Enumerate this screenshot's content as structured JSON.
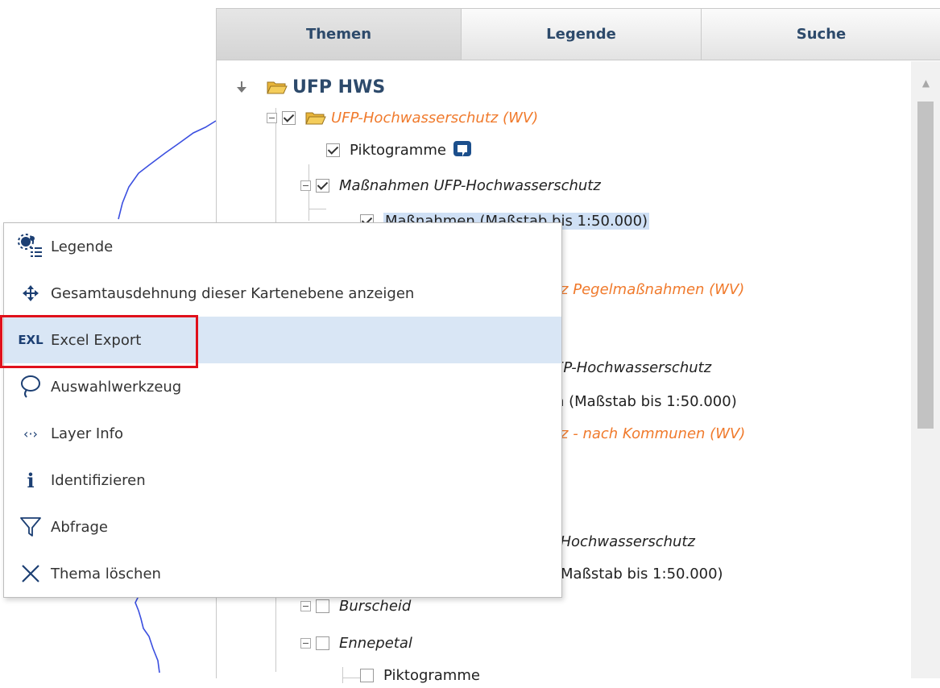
{
  "tabs": [
    {
      "label": "Themen",
      "active": true
    },
    {
      "label": "Legende",
      "active": false
    },
    {
      "label": "Suche",
      "active": false
    }
  ],
  "tree": {
    "root": "UFP HWS",
    "group1": "UFP-Hochwasserschutz (WV)",
    "piktogramme": "Piktogramme",
    "massnahmen_group": "Maßnahmen UFP-Hochwasserschutz",
    "massnahmen_layer": "Maßnahmen (Maßstab bis 1:50.000)",
    "pegel_partial": "tz Pegelmaßnahmen (WV)",
    "massnahmen_group2_partial": "FP-Hochwasserschutz",
    "massnahmen_layer2_partial": "n (Maßstab bis 1:50.000)",
    "kommunen_partial": "tz - nach Kommunen (WV)",
    "massnahmen_group3_partial": "-Hochwasserschutz",
    "massnahmen_layer3_partial": "(Maßstab bis 1:50.000)",
    "burscheid": "Burscheid",
    "ennepetal": "Ennepetal",
    "piktogramme2": "Piktogramme"
  },
  "context_menu": {
    "items": [
      {
        "label": "Legende",
        "icon": "legend-icon"
      },
      {
        "label": "Gesamtausdehnung dieser Kartenebene anzeigen",
        "icon": "move-arrows-icon"
      },
      {
        "label": "Excel Export",
        "icon": "excel-export-icon",
        "icon_text": "EXL",
        "hovered": true,
        "highlighted": true
      },
      {
        "label": "Auswahlwerkzeug",
        "icon": "lasso-icon"
      },
      {
        "label": "Layer Info",
        "icon": "code-arrows-icon",
        "icon_text": "‹·›"
      },
      {
        "label": "Identifizieren",
        "icon": "info-icon",
        "icon_text": "i"
      },
      {
        "label": "Abfrage",
        "icon": "filter-icon"
      },
      {
        "label": "Thema löschen",
        "icon": "close-icon"
      }
    ]
  },
  "colors": {
    "accent_blue": "#2d4a6b",
    "orange_group": "#f07a2c",
    "selection": "#cfe0f5",
    "highlight_border": "#e0101b"
  }
}
